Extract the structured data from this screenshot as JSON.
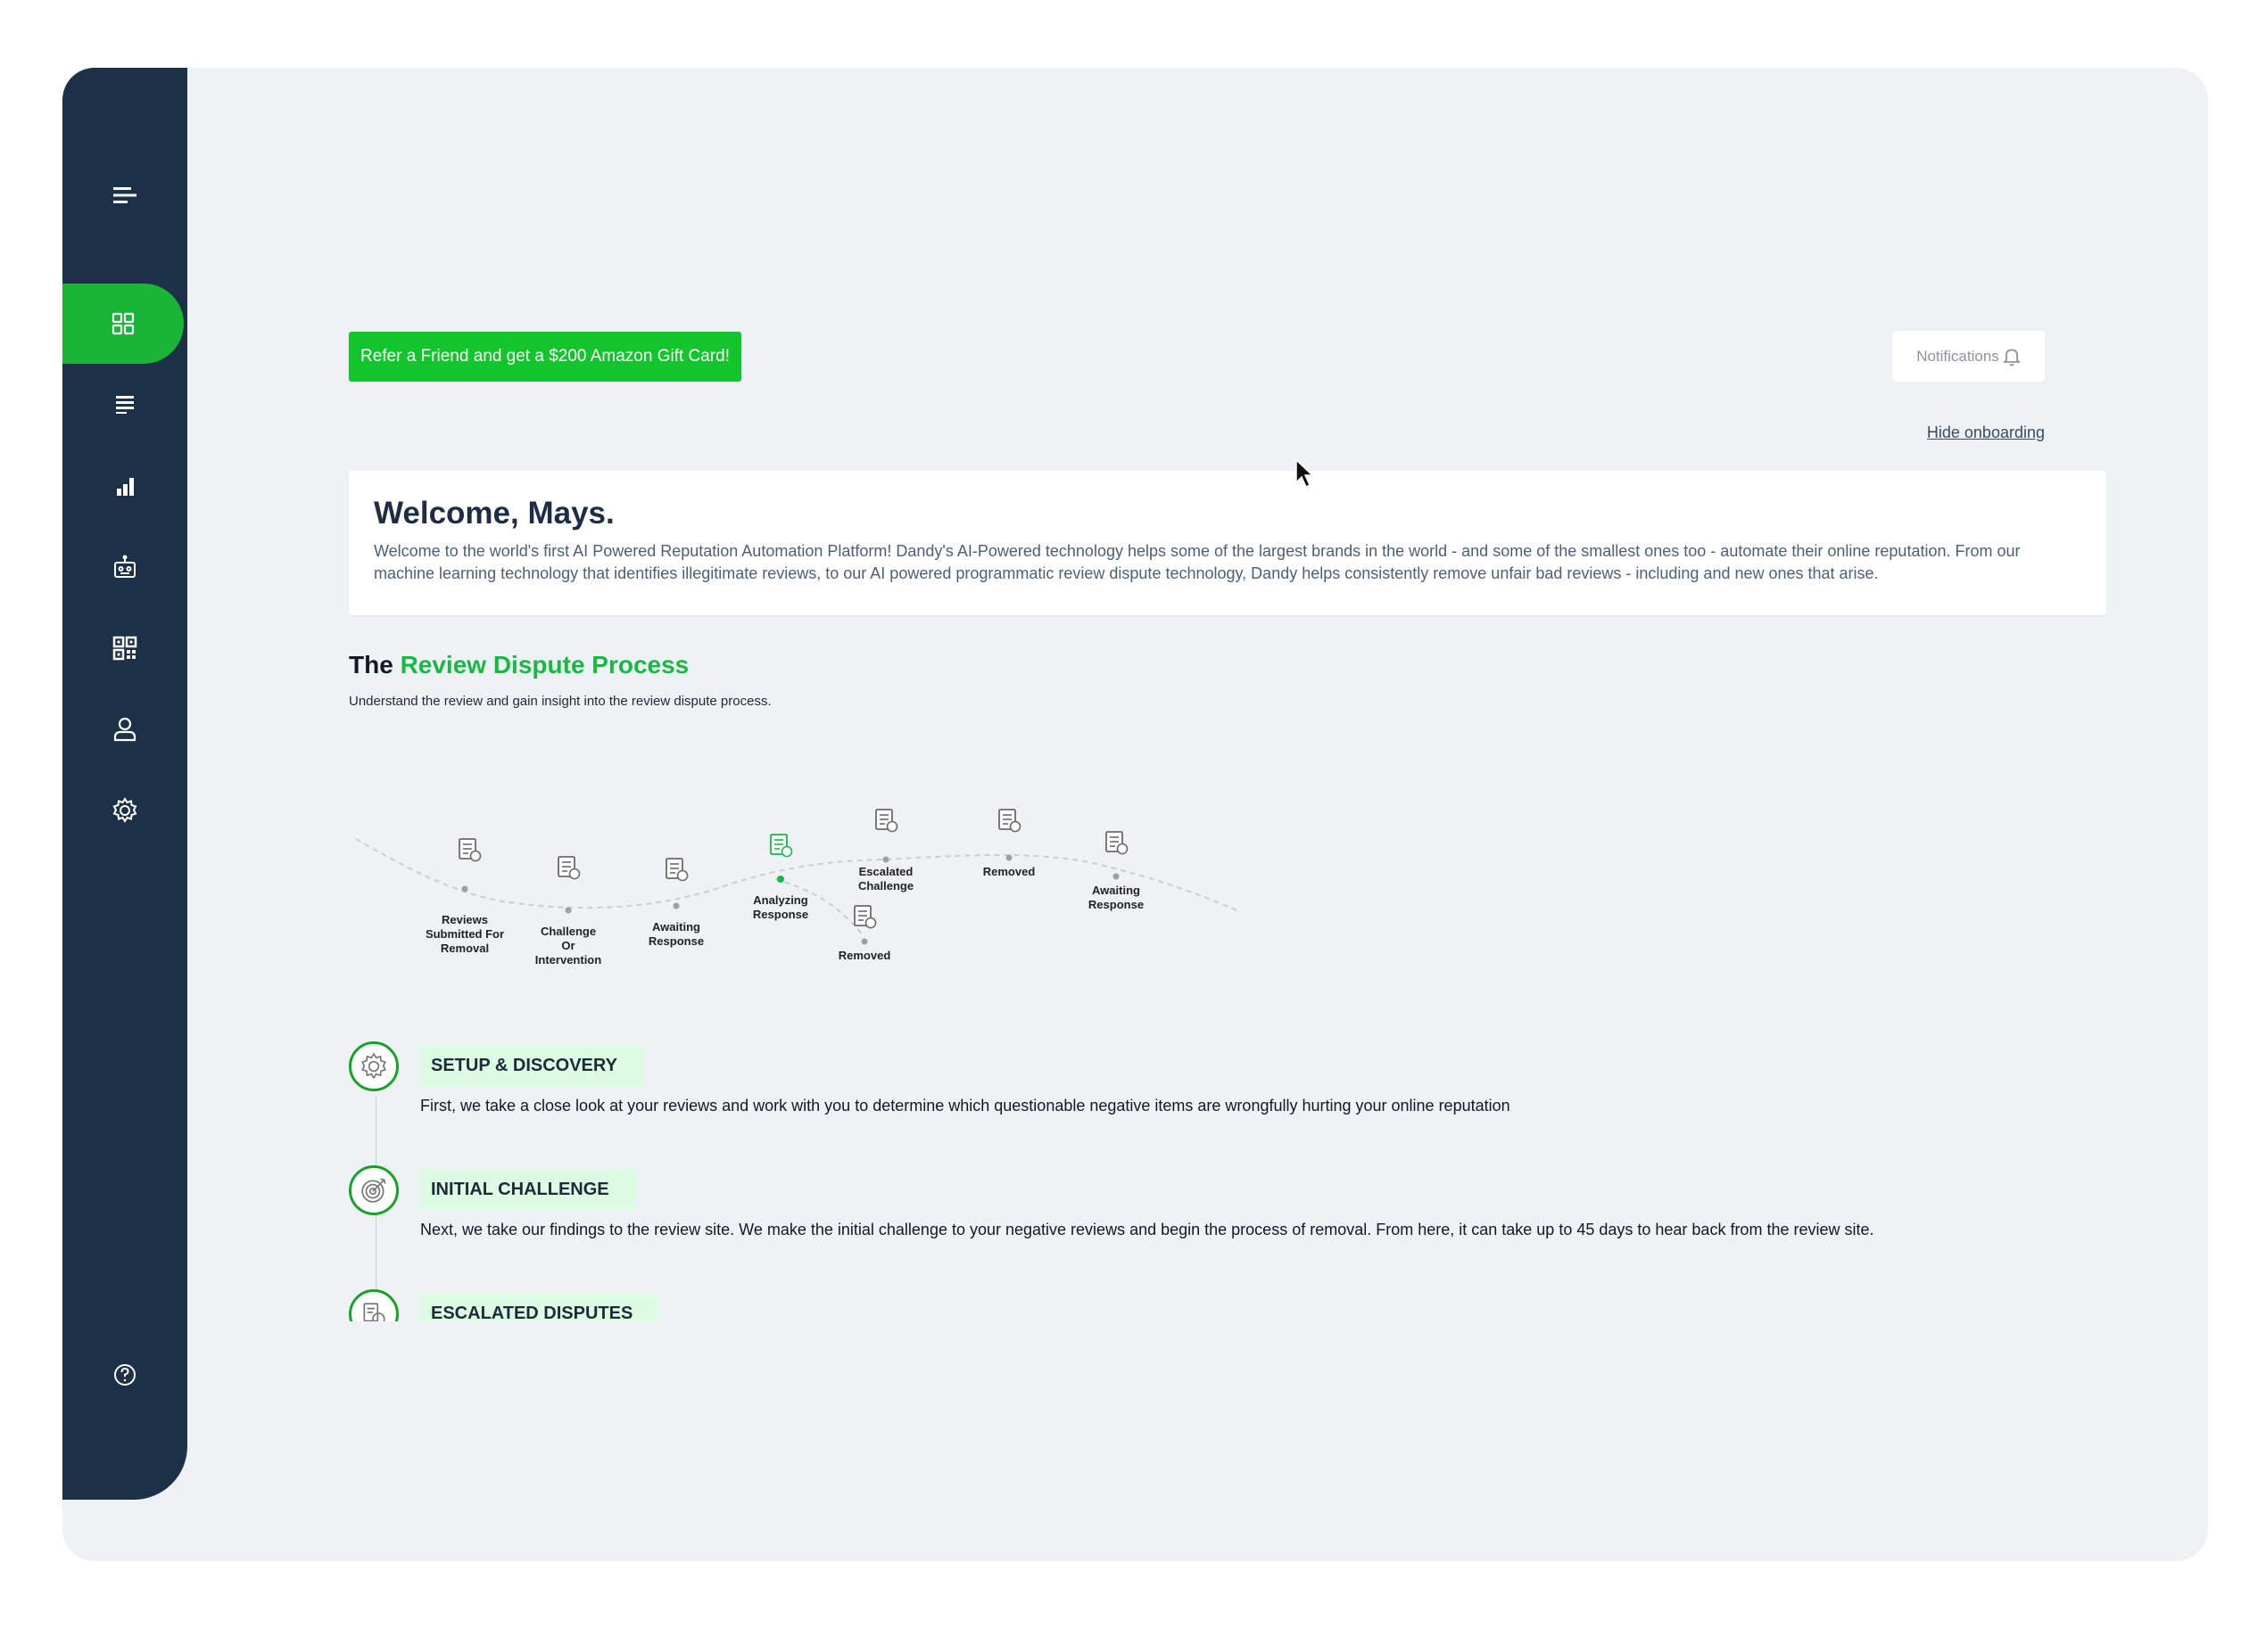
{
  "sidebar": {
    "items": [
      {
        "name": "menu-toggle",
        "icon": "hamburger-icon"
      },
      {
        "name": "dashboard",
        "icon": "grid-icon",
        "active": true
      },
      {
        "name": "reviews",
        "icon": "list-icon"
      },
      {
        "name": "reports",
        "icon": "bar-chart-icon"
      },
      {
        "name": "automation",
        "icon": "robot-icon"
      },
      {
        "name": "qr-codes",
        "icon": "qr-code-icon"
      },
      {
        "name": "profile",
        "icon": "user-icon"
      },
      {
        "name": "settings",
        "icon": "gear-icon"
      },
      {
        "name": "help",
        "icon": "help-icon"
      }
    ]
  },
  "header": {
    "refer_label": "Refer a Friend and get a $200 Amazon Gift Card!",
    "notifications_label": "Notifications",
    "hide_onboarding_label": "Hide onboarding"
  },
  "welcome": {
    "title": "Welcome, Mays.",
    "text": "Welcome to the world's first AI Powered Reputation Automation Platform! Dandy's AI-Powered technology helps some of the largest brands in the world - and some of the smallest ones too - automate their online reputation. From our machine learning technology that identifies illegitimate reviews, to our AI powered programmatic review dispute technology, Dandy helps consistently remove unfair bad reviews - including and new ones that arise."
  },
  "process": {
    "title_prefix": "The",
    "title_accent": "Review Dispute Process",
    "subtitle": "Understand the review and gain insight into the review dispute process.",
    "stages": [
      {
        "label": [
          "Reviews",
          "Submitted For",
          "Removal"
        ],
        "icon": "document-edit-icon"
      },
      {
        "label": [
          "Challenge",
          "Or",
          "Intervention"
        ],
        "icon": "gears-icon"
      },
      {
        "label": [
          "Awaiting",
          "Response"
        ],
        "icon": "clock-person-icon"
      },
      {
        "label": [
          "Analyzing",
          "Response"
        ],
        "icon": "magnifier-document-icon",
        "active": true
      },
      {
        "label": [
          "Escalated",
          "Challenge"
        ],
        "icon": "escalate-icon"
      },
      {
        "label": [
          "Removed"
        ],
        "icon": "shredder-icon"
      },
      {
        "label": [
          "Awaiting",
          "Response"
        ],
        "icon": "timer-document-icon"
      },
      {
        "label": [
          "Removed"
        ],
        "icon": "shredder-icon"
      }
    ]
  },
  "steps": [
    {
      "title": "SETUP & DISCOVERY",
      "icon": "gear-icon",
      "description": "First, we take a close look at your reviews and work with you to determine which questionable negative items are wrongfully hurting your online reputation"
    },
    {
      "title": "INITIAL CHALLENGE",
      "icon": "target-icon",
      "description": "Next, we take our findings to the review site. We make the initial challenge to your negative reviews and begin the process of removal. From here, it can take up to 45 days to hear back from the review site."
    },
    {
      "title": "ESCALATED DISPUTES",
      "icon": "escalate-icon",
      "description": ""
    }
  ],
  "colors": {
    "sidebar": "#1c3048",
    "accent_green": "#13c52d",
    "background": "#eef2f5"
  }
}
